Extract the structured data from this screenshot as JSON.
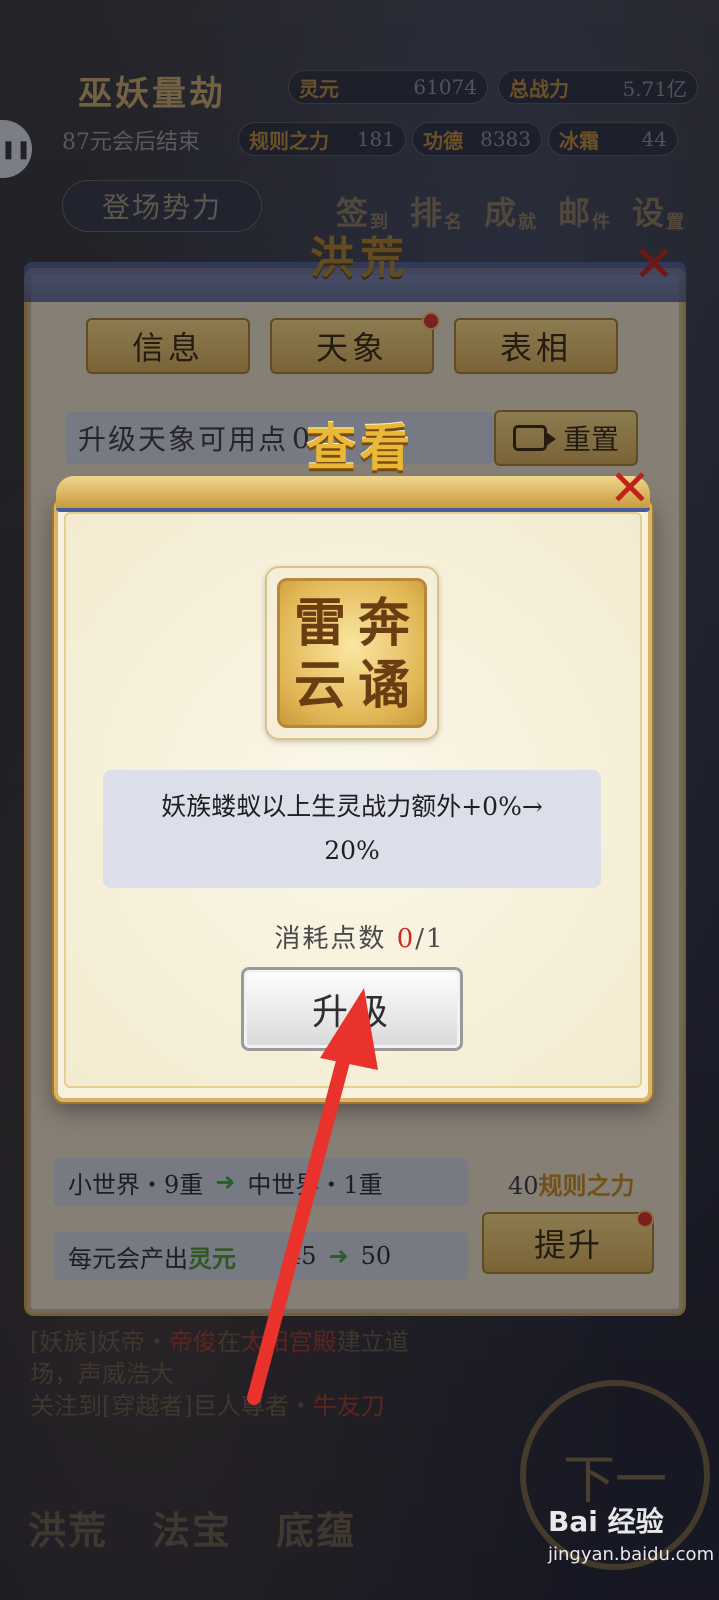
{
  "hud": {
    "title": "巫妖量劫",
    "countdown": "87元会后结束",
    "faction_button": "登场势力",
    "stats": [
      {
        "key": "灵元",
        "value": "61074"
      },
      {
        "key": "总战力",
        "value": "5.71亿"
      },
      {
        "key": "规则之力",
        "value": "181"
      },
      {
        "key": "功德",
        "value": "8383"
      },
      {
        "key": "冰霜",
        "value": "44"
      }
    ],
    "menu": [
      {
        "main": "签",
        "sub": "到"
      },
      {
        "main": "排",
        "sub": "名"
      },
      {
        "main": "成",
        "sub": "就"
      },
      {
        "main": "邮",
        "sub": "件"
      },
      {
        "main": "设",
        "sub": "置"
      }
    ]
  },
  "panel": {
    "title": "洪荒",
    "tabs": [
      "信息",
      "天象",
      "表相"
    ],
    "available_points_label": "升级天象可用点",
    "available_points_value": "0",
    "reset_label": "重置",
    "world_from": "小世界・9重",
    "world_to": "中世界・1重",
    "produce_label": "每元会产出",
    "produce_resource": "灵元",
    "produce_from": "45",
    "produce_to": "50",
    "improve_cost_amount": "40",
    "improve_cost_resource": "规则之力",
    "improve_label": "提升"
  },
  "log": {
    "line1_prefix": "[妖族]妖帝・",
    "line1_name": "帝俊",
    "line1_mid": "在",
    "line1_place": "太阳宫殿",
    "line1_suffix": "建立道",
    "line2": "场，声威浩大",
    "line3_prefix": "关注到[穿越者]巨人尊者・",
    "line3_name": "牛友刀"
  },
  "bottom_nav": [
    "洪荒",
    "法宝",
    "底蕴"
  ],
  "next_label": "下一",
  "modal": {
    "title": "查看",
    "seal_chars": [
      "雷",
      "奔",
      "云",
      "谲"
    ],
    "description_line1": "妖族蝼蚁以上生灵战力额外+0%→",
    "description_line2": "20%",
    "consume_label": "消耗点数",
    "consume_current": "0",
    "consume_total": "/1",
    "upgrade_label": "升级"
  },
  "watermark": {
    "brand": "Bai 经验",
    "url": "jingyan.baidu.com"
  },
  "colors": {
    "annotation_arrow": "#e8322b",
    "accent_gold": "#d5ad55",
    "highlight_red": "#d22b1d",
    "green_arrow": "#3fa63b"
  }
}
